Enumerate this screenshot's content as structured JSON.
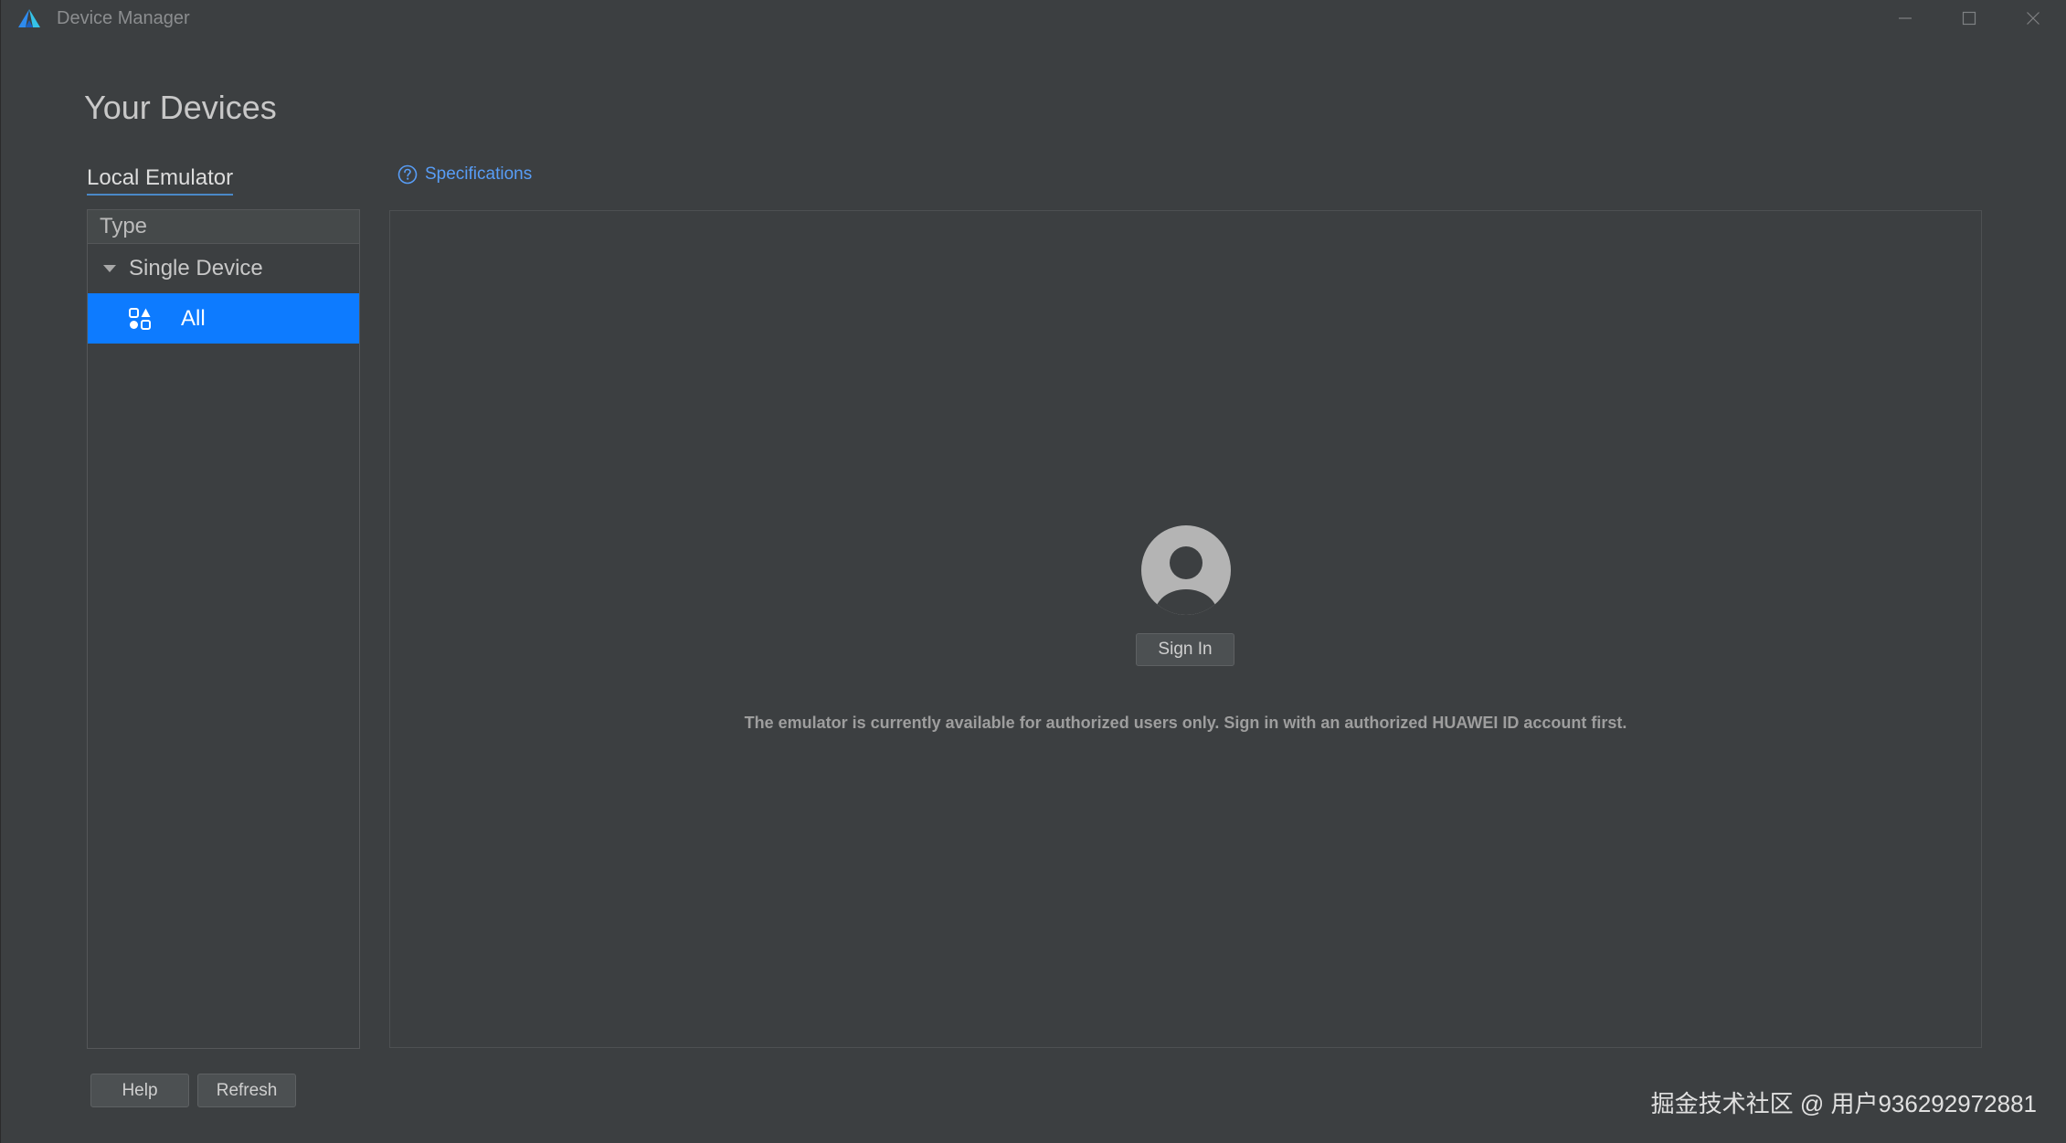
{
  "window": {
    "title": "Device Manager",
    "logo_icon": "huawei-devecostudio-logo",
    "controls": [
      "minimize-icon",
      "maximize-icon",
      "close-icon"
    ]
  },
  "page": {
    "title": "Your Devices",
    "tab_local": "Local Emulator",
    "spec_link": "Specifications"
  },
  "type_panel": {
    "header": "Type",
    "group_label": "Single Device",
    "selected_item": "All"
  },
  "main": {
    "signin_label": "Sign In",
    "notice": "The emulator is currently available for authorized users only. Sign in with an authorized HUAWEI ID account first."
  },
  "footer": {
    "help_label": "Help",
    "refresh_label": "Refresh"
  },
  "watermark": "掘金技术社区 @ 用户936292972881",
  "colors": {
    "background": "#3c3f41",
    "accent": "#0d7bff",
    "link": "#589df6"
  }
}
